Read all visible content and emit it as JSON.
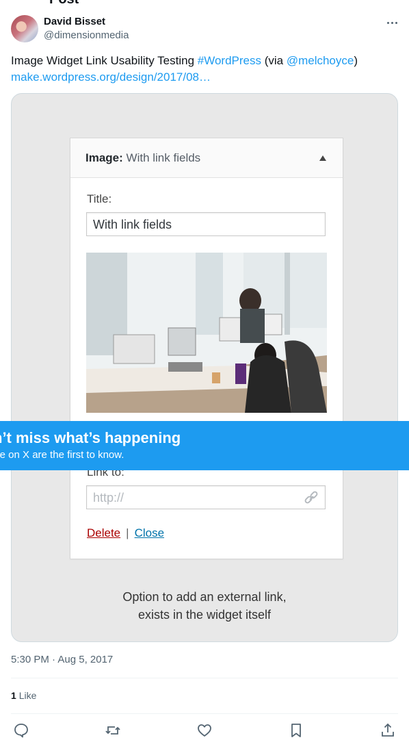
{
  "header": {
    "partial_title": "Post"
  },
  "author": {
    "name": "David Bisset",
    "handle": "@dimensionmedia"
  },
  "tweet": {
    "text_before": "Image Widget Link Usability Testing ",
    "hashtag": "#WordPress",
    "text_mid": " (via ",
    "mention": "@melchoyce",
    "text_after": ")",
    "link": "make.wordpress.org/design/2017/08…"
  },
  "media": {
    "widget": {
      "title_bold": "Image:",
      "title_rest": "With link fields",
      "title_label": "Title:",
      "title_value": "With link fields",
      "link_label": "Link to:",
      "link_placeholder": "http://",
      "delete_label": "Delete",
      "separator": "|",
      "close_label": "Close"
    },
    "caption_line1": "Option to add an external link,",
    "caption_line2": "exists in the widget itself"
  },
  "banner": {
    "title": "n’t miss what’s happening",
    "subtitle": "ple on X are the first to know."
  },
  "meta": {
    "timestamp": "5:30 PM · Aug 5, 2017"
  },
  "stats": {
    "likes_count": "1",
    "likes_label": "Like"
  },
  "actions": [
    "reply-icon",
    "repost-icon",
    "like-icon",
    "bookmark-icon",
    "share-icon"
  ],
  "colors": {
    "accent": "#1d9bf0",
    "text": "#0f1419",
    "muted": "#536471"
  }
}
